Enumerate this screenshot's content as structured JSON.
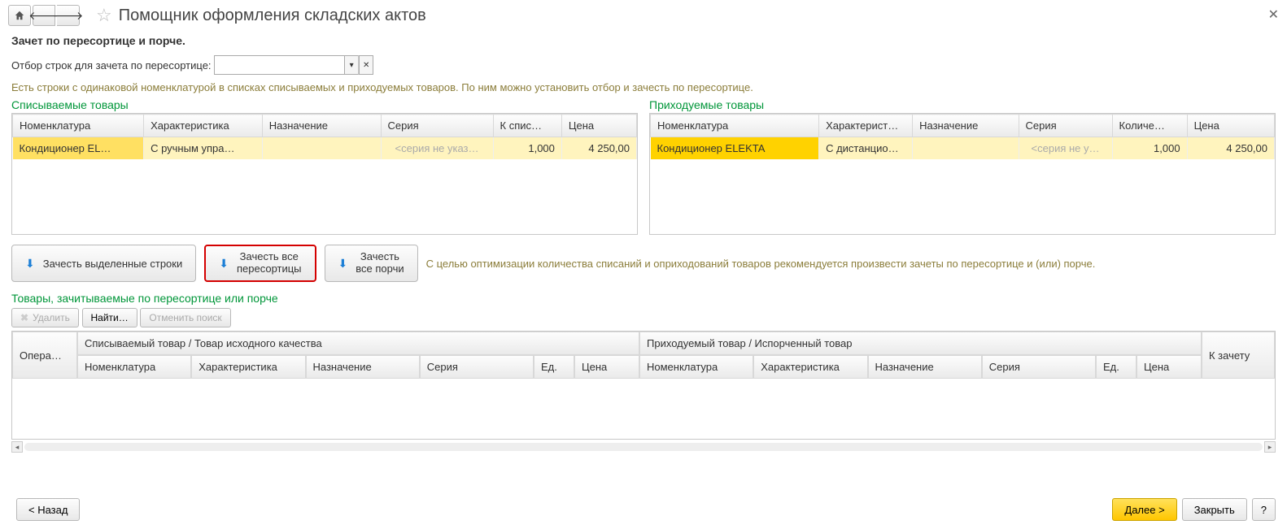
{
  "titlebar": {
    "title": "Помощник оформления складских актов"
  },
  "section": {
    "heading": "Зачет по пересортице и порче.",
    "filter_label": "Отбор строк для зачета по пересортице:",
    "filter_value": "",
    "info": "Есть строки с одинаковой номенклатурой в списках списываемых и приходуемых товаров. По ним можно установить отбор и зачесть по пересортице."
  },
  "left": {
    "caption": "Списываемые товары",
    "cols": [
      "Номенклатура",
      "Характеристика",
      "Назначение",
      "Серия",
      "К спис…",
      "Цена"
    ],
    "row": {
      "nomen": "Кондиционер EL…",
      "char": "С ручным упра…",
      "dest": "",
      "series": "<серия не указ…",
      "qty": "1,000",
      "price": "4 250,00"
    }
  },
  "right": {
    "caption": "Приходуемые товары",
    "cols": [
      "Номенклатура",
      "Характерист…",
      "Назначение",
      "Серия",
      "Количе…",
      "Цена"
    ],
    "row": {
      "nomen": "Кондиционер ELEKTA",
      "char": "С дистанцио…",
      "dest": "",
      "series": "<серия не у…",
      "qty": "1,000",
      "price": "4 250,00"
    }
  },
  "buttons": {
    "b1": "Зачесть выделенные строки",
    "b2a": "Зачесть все",
    "b2b": "пересортицы",
    "b3a": "Зачесть",
    "b3b": "все порчи",
    "hint": "С целью оптимизации количества списаний и оприходований товаров рекомендуется произвести зачеты по пересортице и (или) порче."
  },
  "bottom": {
    "caption": "Товары, зачитываемые по пересортице или порче",
    "delete": "Удалить",
    "find": "Найти…",
    "cancel_find": "Отменить поиск",
    "h_opera": "Опера…",
    "h_group1": "Списываемый товар / Товар исходного качества",
    "h_group2": "Приходуемый товар / Испорченный товар",
    "h_zachet": "К зачету",
    "sub": [
      "Номенклатура",
      "Характеристика",
      "Назначение",
      "Серия",
      "Ед.",
      "Цена",
      "Номенклатура",
      "Характеристика",
      "Назначение",
      "Серия",
      "Ед.",
      "Цена"
    ]
  },
  "footer": {
    "back": "< Назад",
    "next": "Далее >",
    "close": "Закрыть",
    "help": "?"
  }
}
